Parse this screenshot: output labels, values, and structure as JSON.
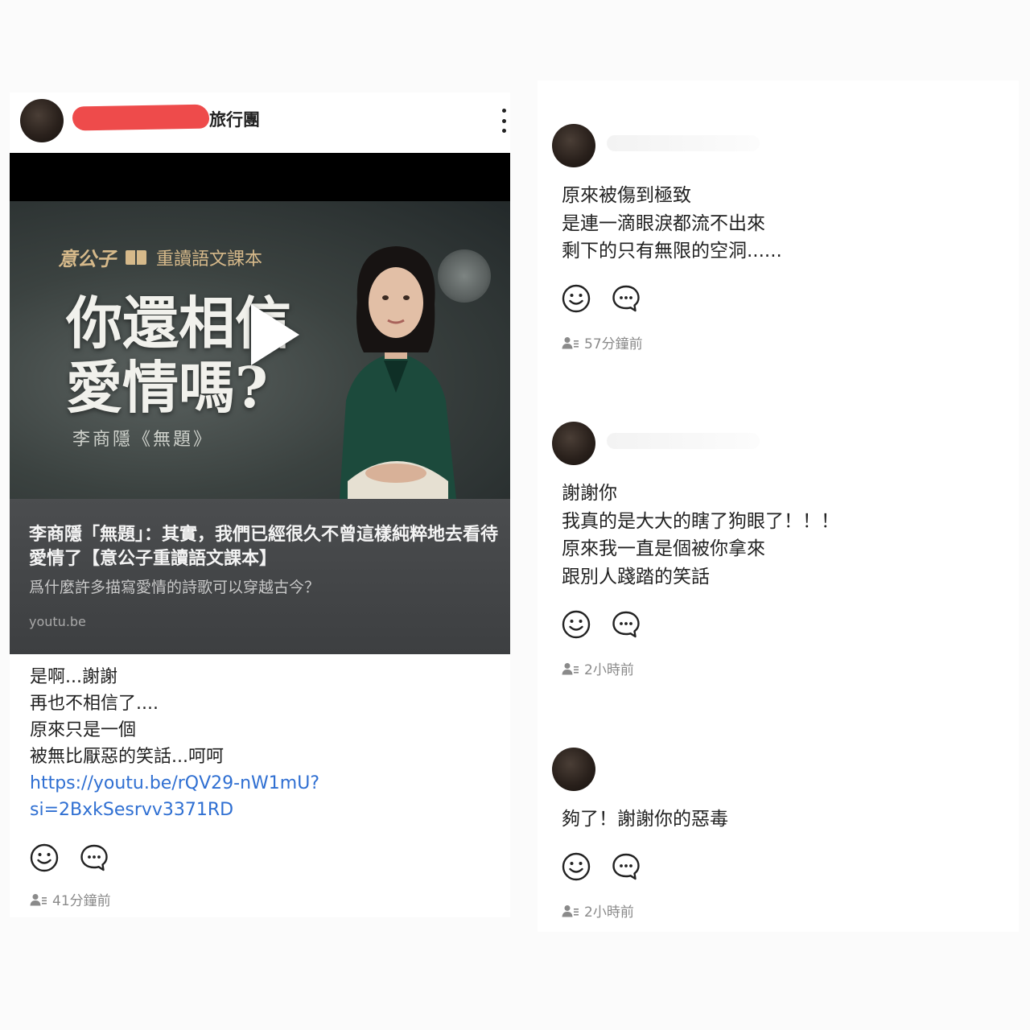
{
  "post": {
    "group_name": "旅行團",
    "link_preview": {
      "brand": "意公子",
      "series": "重讀語文課本",
      "headline_line1": "你還相信",
      "headline_line2": "愛情嗎?",
      "poem": "李商隱《無題》",
      "title": "李商隱「無題」：其實，我們已經很久不曾這樣純粹地去看待愛情了【意公子重讀語文課本】",
      "description": "爲什麼許多描寫愛情的詩歌可以穿越古今？",
      "domain": "youtu.be"
    },
    "body_lines": [
      "是啊...謝謝",
      "再也不相信了....",
      "原來只是一個",
      "被無比厭惡的笑話...呵呵"
    ],
    "link_line1": "https://youtu.be/rQV29-nW1mU?",
    "link_line2": "si=2BxkSesrvv3371RD",
    "time": "41分鐘前"
  },
  "comments": [
    {
      "lines": [
        "原來被傷到極致",
        "是連一滴眼淚都流不出來",
        "剩下的只有無限的空洞......"
      ],
      "time": "57分鐘前"
    },
    {
      "lines": [
        "謝謝你",
        "我真的是大大的瞎了狗眼了！！！",
        "原來我一直是個被你拿來",
        "跟別人踐踏的笑話"
      ],
      "time": "2小時前"
    },
    {
      "lines": [
        "夠了！謝謝你的惡毒"
      ],
      "time": "2小時前"
    }
  ],
  "icons": {
    "react": "smiley-icon",
    "comment": "chat-bubble-icon",
    "audience": "people-icon",
    "more": "more-vertical-icon",
    "play": "play-icon"
  },
  "colors": {
    "link": "#2f6fd2",
    "redaction": "#ee4b4b",
    "caption_bg": "#444648",
    "brand_gold": "#d6b98a"
  }
}
